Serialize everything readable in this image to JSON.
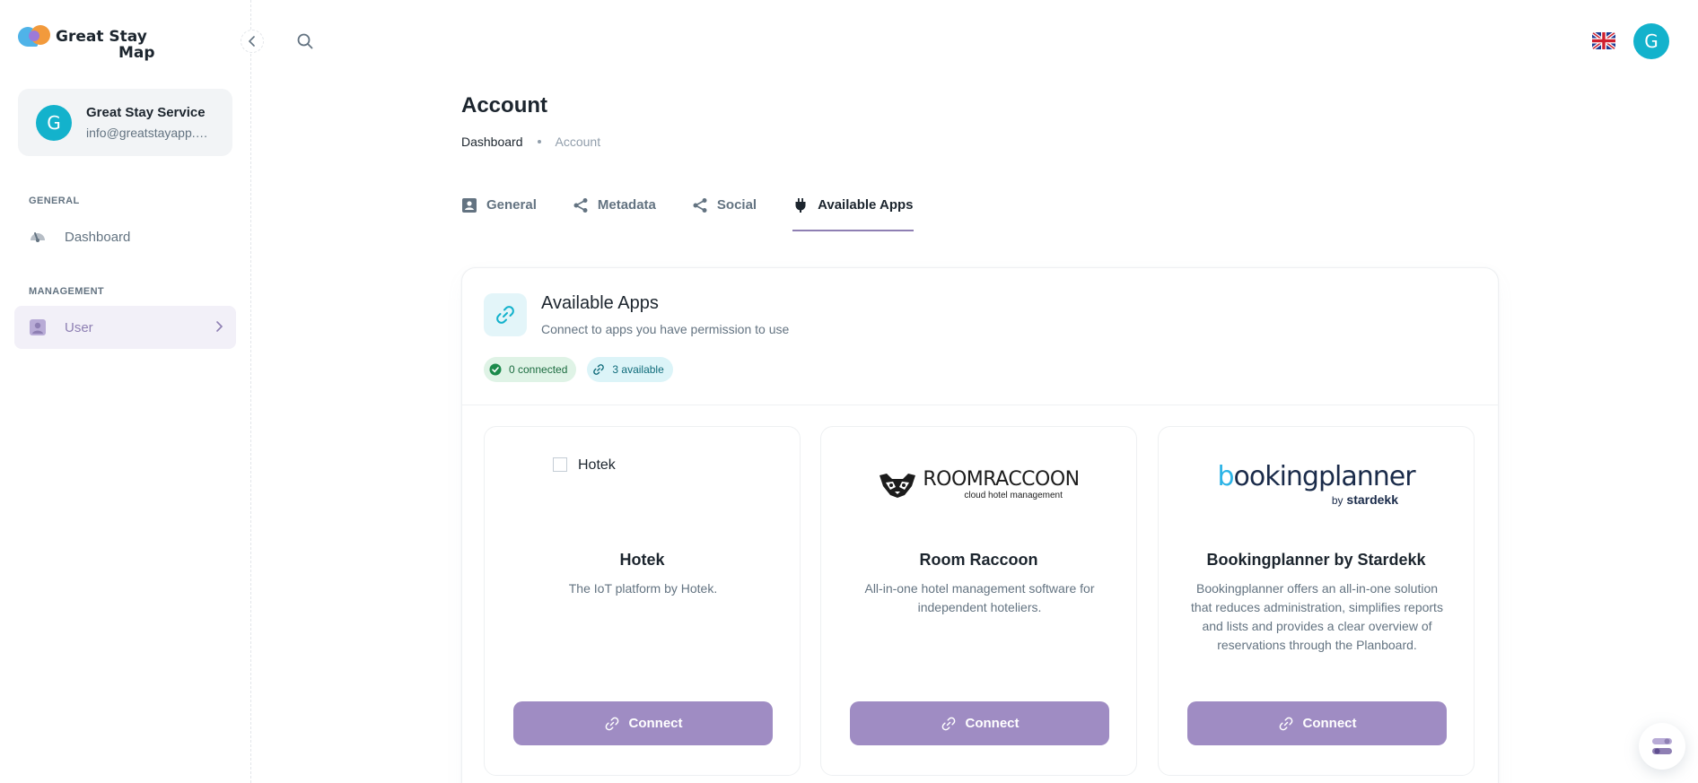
{
  "brand": {
    "line1": "Great Stay",
    "line2": "Map"
  },
  "account": {
    "initial": "G",
    "name": "Great Stay Service",
    "email": "info@greatstayapp.com"
  },
  "nav": {
    "general_header": "GENERAL",
    "dashboard": "Dashboard",
    "management_header": "MANAGEMENT",
    "user": "User"
  },
  "header": {
    "avatar_initial": "G",
    "language": "en-GB"
  },
  "page": {
    "title": "Account"
  },
  "breadcrumb": {
    "home": "Dashboard",
    "current": "Account"
  },
  "tabs": [
    {
      "label": "General",
      "icon": "contact-card-icon",
      "active": false
    },
    {
      "label": "Metadata",
      "icon": "share-icon",
      "active": false
    },
    {
      "label": "Social",
      "icon": "share-icon",
      "active": false
    },
    {
      "label": "Available Apps",
      "icon": "plug-icon",
      "active": true
    }
  ],
  "panel": {
    "title": "Available Apps",
    "subtitle": "Connect to apps you have permission to use",
    "chips": {
      "connected": "0 connected",
      "available": "3 available"
    }
  },
  "apps": [
    {
      "name": "Hotek",
      "logo_alt": "Hotek",
      "description": "The IoT platform by Hotek.",
      "button": "Connect"
    },
    {
      "name": "Room Raccoon",
      "logo_main": "ROOMRACCOON",
      "logo_sub": "cloud hotel management",
      "description": "All-in-one hotel management software for independent hoteliers.",
      "button": "Connect"
    },
    {
      "name": "Bookingplanner by Stardekk",
      "logo_main_b": "b",
      "logo_main_rest": "ookingplanner",
      "logo_sub_by": "by",
      "logo_sub_brand": "stardekk",
      "description": "Bookingplanner offers an all-in-one solution that reduces administration, simplifies reports and lists and provides a clear overview of reservations through the Planboard.",
      "button": "Connect"
    }
  ],
  "colors": {
    "accent": "#9f8cc3",
    "avatar": "#13b2cc",
    "tab_indicator": "#8e7fb3"
  }
}
